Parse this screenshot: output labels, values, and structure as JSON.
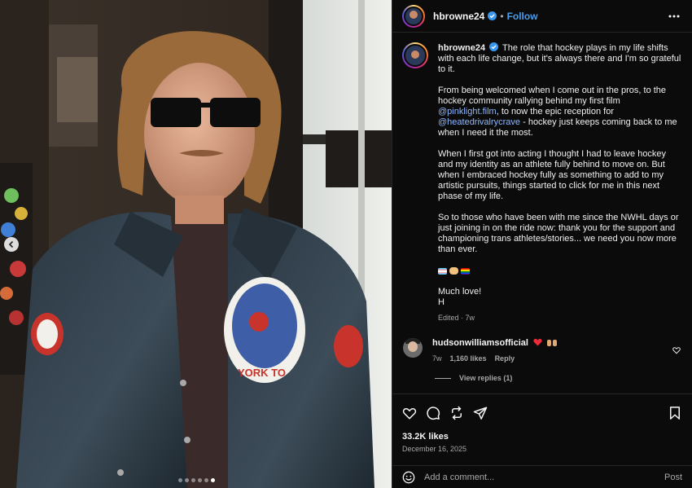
{
  "photo": {
    "patch_text": "YORK TO",
    "carousel_dots": 6,
    "active_dot": 6
  },
  "header": {
    "username": "hbrowne24",
    "verified": true,
    "follow_label": "Follow",
    "more_icon": "more-horizontal-icon"
  },
  "caption": {
    "username": "hbrowne24",
    "p1": "The role that hockey plays in my life shifts with each life change, but it's always there and I'm so grateful to it.",
    "p2_a": "From being welcomed when I come out in the pros, to the hockey community rallying behind my first film ",
    "p2_mention1": "@pinklight.film",
    "p2_b": ", to now the epic reception for ",
    "p2_mention2": "@heatedrivalrycrave",
    "p2_c": " - hockey just keeps coming back to me when I need it the most.",
    "p3": "When I first got into acting I thought I had to leave hockey and my identity as an athlete fully behind to move on. But when I embraced hockey fully as something to add to my artistic pursuits, things started to click for me in this next phase of my life.",
    "p4": "So to those who have been with me since the NWHL days or just joining in on the ride now: thank you for the support and championing trans athletes/stories... we need you now more than ever.",
    "emojis": [
      "transgender-flag",
      "handshake",
      "rainbow-flag"
    ],
    "signoff_1": "Much love!",
    "signoff_2": "H",
    "meta": "Edited · 7w"
  },
  "comment": {
    "username": "hudsonwilliamsofficial",
    "emojis": [
      "red-heart",
      "raised-hands"
    ],
    "age": "7w",
    "likes": "1,160 likes",
    "reply_label": "Reply",
    "view_replies": "View replies (1)"
  },
  "actions": {
    "likes": "33.2K likes",
    "date": "December 16, 2025"
  },
  "add_comment": {
    "placeholder": "Add a comment...",
    "post_label": "Post"
  },
  "colors": {
    "accent_blue": "#4a9dec",
    "mention": "#8fb8ff",
    "background": "#0b0b0b"
  }
}
